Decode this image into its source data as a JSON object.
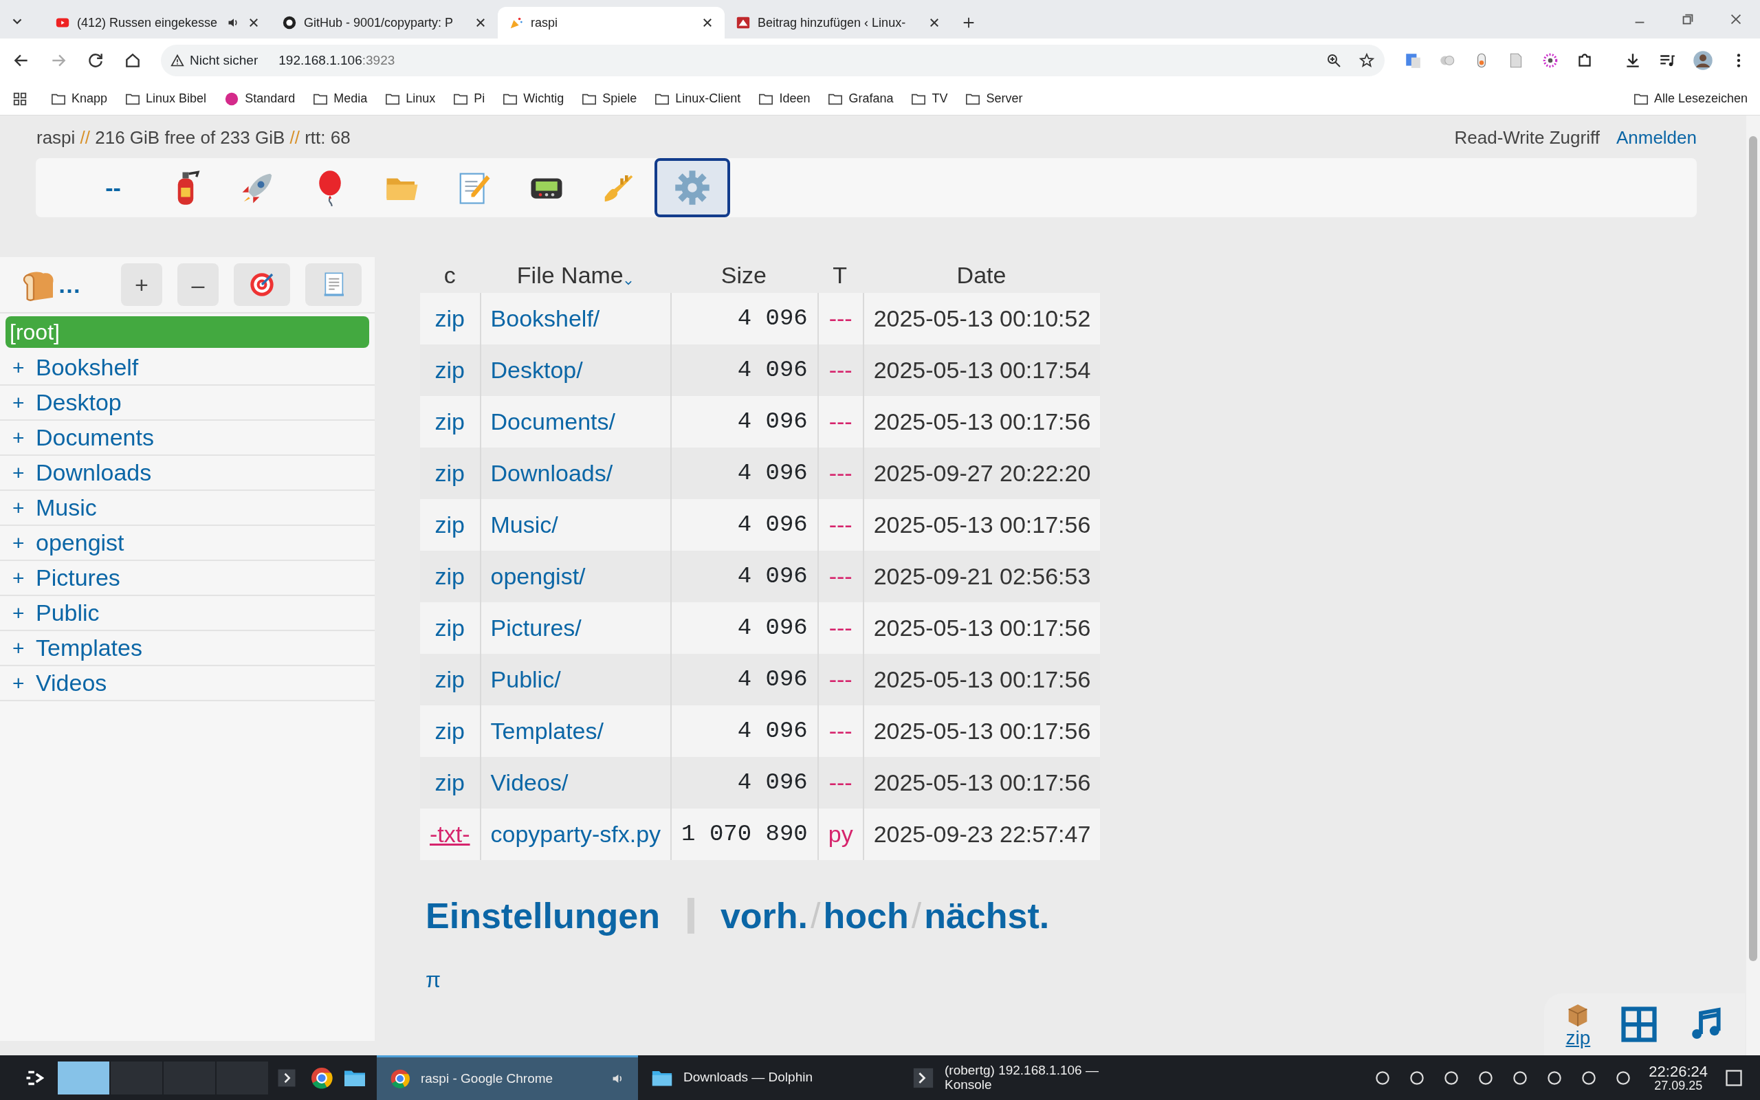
{
  "browser": {
    "tabs": [
      {
        "title": "(412) Russen eingekesse",
        "audio": true,
        "selected": false
      },
      {
        "title": "GitHub - 9001/copyparty: P",
        "audio": false,
        "selected": false
      },
      {
        "title": "raspi",
        "audio": false,
        "selected": true
      },
      {
        "title": "Beitrag hinzufügen ‹ Linux-",
        "audio": false,
        "selected": false
      }
    ],
    "address": {
      "security": "Nicht sicher",
      "host": "192.168.1.106",
      "port": ":3923"
    },
    "bookmarks": [
      {
        "label": "Knapp",
        "kind": "folder"
      },
      {
        "label": "Linux Bibel",
        "kind": "folder"
      },
      {
        "label": "Standard",
        "kind": "site"
      },
      {
        "label": "Media",
        "kind": "folder"
      },
      {
        "label": "Linux",
        "kind": "folder"
      },
      {
        "label": "Pi",
        "kind": "folder"
      },
      {
        "label": "Wichtig",
        "kind": "folder"
      },
      {
        "label": "Spiele",
        "kind": "folder"
      },
      {
        "label": "Linux-Client",
        "kind": "folder"
      },
      {
        "label": "Ideen",
        "kind": "folder"
      },
      {
        "label": "Grafana",
        "kind": "folder"
      },
      {
        "label": "TV",
        "kind": "folder"
      },
      {
        "label": "Server",
        "kind": "folder"
      }
    ],
    "all_bookmarks": "Alle Lesezeichen"
  },
  "page": {
    "status": {
      "host": "raspi",
      "sep1": "//",
      "free": "216 GiB free of 233 GiB",
      "sep2": "//",
      "rtt": "rtt: 68"
    },
    "access": "Read-Write Zugriff",
    "login": "Anmelden",
    "toolbar": [
      {
        "kind": "text",
        "label": "--",
        "selected": false
      },
      {
        "kind": "extinguisher",
        "selected": false
      },
      {
        "kind": "rocket",
        "selected": false
      },
      {
        "kind": "balloon",
        "selected": false
      },
      {
        "kind": "folder",
        "selected": false
      },
      {
        "kind": "notepad",
        "selected": false
      },
      {
        "kind": "pager",
        "selected": false
      },
      {
        "kind": "trumpet",
        "selected": false
      },
      {
        "kind": "gear",
        "selected": true
      }
    ],
    "sidebar": {
      "ellipsis": "…",
      "buttons": [
        {
          "kind": "text",
          "label": "+"
        },
        {
          "kind": "text",
          "label": "–"
        },
        {
          "kind": "target"
        },
        {
          "kind": "document"
        }
      ],
      "tree": [
        {
          "label": "[root]",
          "selected": true
        },
        {
          "label": "Bookshelf",
          "expander": "+",
          "selected": false
        },
        {
          "label": "Desktop",
          "expander": "+",
          "selected": false
        },
        {
          "label": "Documents",
          "expander": "+",
          "selected": false
        },
        {
          "label": "Downloads",
          "expander": "+",
          "selected": false
        },
        {
          "label": "Music",
          "expander": "+",
          "selected": false
        },
        {
          "label": "opengist",
          "expander": "+",
          "selected": false
        },
        {
          "label": "Pictures",
          "expander": "+",
          "selected": false
        },
        {
          "label": "Public",
          "expander": "+",
          "selected": false
        },
        {
          "label": "Templates",
          "expander": "+",
          "selected": false
        },
        {
          "label": "Videos",
          "expander": "+",
          "selected": false
        }
      ]
    },
    "table": {
      "columns": [
        {
          "label": "c",
          "sorted": false
        },
        {
          "label": "File Name",
          "sorted": true
        },
        {
          "label": "Size",
          "sorted": false
        },
        {
          "label": "T",
          "sorted": false
        },
        {
          "label": "Date",
          "sorted": false
        }
      ],
      "rows": [
        {
          "kind": "dir",
          "action": "zip",
          "name": "Bookshelf/",
          "size": "4 096",
          "type": "---",
          "date": "2025-05-13 00:10:52"
        },
        {
          "kind": "dir",
          "action": "zip",
          "name": "Desktop/",
          "size": "4 096",
          "type": "---",
          "date": "2025-05-13 00:17:54"
        },
        {
          "kind": "dir",
          "action": "zip",
          "name": "Documents/",
          "size": "4 096",
          "type": "---",
          "date": "2025-05-13 00:17:56"
        },
        {
          "kind": "dir",
          "action": "zip",
          "name": "Downloads/",
          "size": "4 096",
          "type": "---",
          "date": "2025-09-27 20:22:20"
        },
        {
          "kind": "dir",
          "action": "zip",
          "name": "Music/",
          "size": "4 096",
          "type": "---",
          "date": "2025-05-13 00:17:56"
        },
        {
          "kind": "dir",
          "action": "zip",
          "name": "opengist/",
          "size": "4 096",
          "type": "---",
          "date": "2025-09-21 02:56:53"
        },
        {
          "kind": "dir",
          "action": "zip",
          "name": "Pictures/",
          "size": "4 096",
          "type": "---",
          "date": "2025-05-13 00:17:56"
        },
        {
          "kind": "dir",
          "action": "zip",
          "name": "Public/",
          "size": "4 096",
          "type": "---",
          "date": "2025-05-13 00:17:56"
        },
        {
          "kind": "dir",
          "action": "zip",
          "name": "Templates/",
          "size": "4 096",
          "type": "---",
          "date": "2025-05-13 00:17:56"
        },
        {
          "kind": "dir",
          "action": "zip",
          "name": "Videos/",
          "size": "4 096",
          "type": "---",
          "date": "2025-05-13 00:17:56"
        },
        {
          "kind": "file",
          "action": "-txt-",
          "name": "copyparty-sfx.py",
          "size": "1 070 890",
          "type": "py",
          "date": "2025-09-23 22:57:47"
        }
      ]
    },
    "footer": {
      "settings": "Einstellungen",
      "nav": [
        {
          "kind": "link",
          "label": "vorh."
        },
        {
          "kind": "sep",
          "label": "/"
        },
        {
          "kind": "link",
          "label": "hoch"
        },
        {
          "kind": "sep",
          "label": "/"
        },
        {
          "kind": "link",
          "label": "nächst."
        }
      ],
      "pi": "π"
    },
    "dock": {
      "zip_label": "zip"
    }
  },
  "taskbar": {
    "desktops": [
      {
        "selected": true
      },
      {
        "selected": false
      },
      {
        "selected": false
      },
      {
        "selected": false
      }
    ],
    "tasks": [
      {
        "title": "raspi - Google Chrome",
        "selected": true
      },
      {
        "title": "Downloads — Dolphin",
        "selected": false
      },
      {
        "title": "(robertg) 192.168.1.106 — Konsole",
        "selected": false
      }
    ],
    "time": "22:26:24",
    "date": "27.09.25"
  }
}
